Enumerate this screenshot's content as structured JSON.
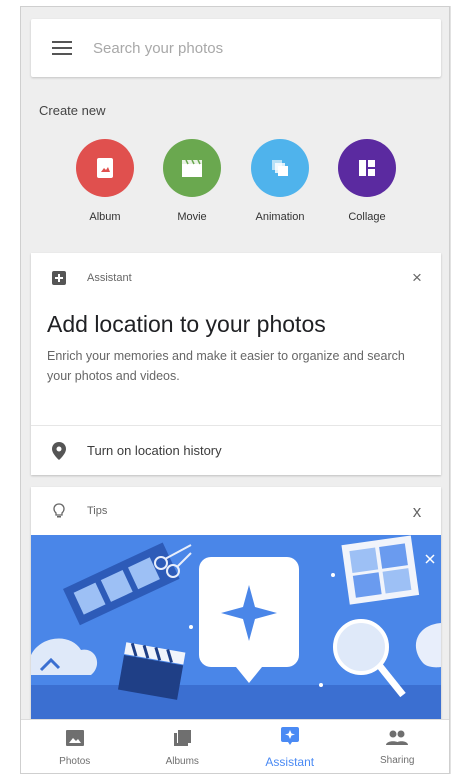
{
  "search": {
    "placeholder": "Search your photos"
  },
  "create_new": {
    "title": "Create new",
    "items": [
      {
        "label": "Album",
        "icon": "album-icon",
        "color": "#e0504e"
      },
      {
        "label": "Movie",
        "icon": "movie-icon",
        "color": "#6aa84f"
      },
      {
        "label": "Animation",
        "icon": "animation-icon",
        "color": "#4fb3ec"
      },
      {
        "label": "Collage",
        "icon": "collage-icon",
        "color": "#5b2aa0"
      }
    ]
  },
  "assistant_card": {
    "header": "Assistant",
    "icon": "assistant-plus-icon",
    "close": "×",
    "headline": "Add location to your photos",
    "body": "Enrich your memories and make it easier to organize and search your photos and videos.",
    "action": "Turn on location history",
    "action_icon": "location-pin-icon"
  },
  "tips_card": {
    "header": "Tips",
    "icon": "lightbulb-icon",
    "close": "x",
    "illustration_color": "#4a86e8"
  },
  "bottom_nav": [
    {
      "label": "Photos",
      "icon": "photo-icon",
      "active": false
    },
    {
      "label": "Albums",
      "icon": "albums-icon",
      "active": false
    },
    {
      "label": "Assistant",
      "icon": "assistant-icon",
      "active": true
    },
    {
      "label": "Sharing",
      "icon": "people-icon",
      "active": false
    }
  ],
  "colors": {
    "accent": "#4a8af4",
    "background": "#eeeeee"
  }
}
